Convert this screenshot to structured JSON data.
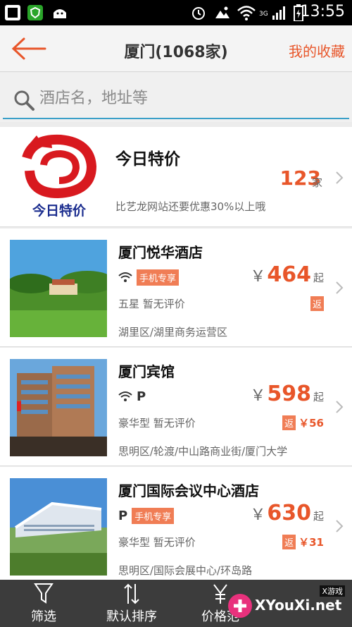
{
  "status_bar": {
    "network": "3G",
    "time": "13:55"
  },
  "header": {
    "title": "厦门(1068家)",
    "favorites_label": "我的收藏"
  },
  "search": {
    "placeholder": "酒店名，地址等"
  },
  "promo": {
    "logo_caption": "今日特价",
    "title": "今日特价",
    "count": "123",
    "unit": "家",
    "description": "比艺龙网站还要优惠30%以上哦"
  },
  "hotels": [
    {
      "name": "厦门悦华酒店",
      "tag": "手机专享",
      "parking": "",
      "currency": "￥",
      "price": "464",
      "price_suffix": "起",
      "grade": "五星  暂无评价",
      "rebate_label": "返",
      "rebate_value": "",
      "address": "湖里区/湖里商务运营区"
    },
    {
      "name": "厦门宾馆",
      "tag": "",
      "parking": "P",
      "currency": "￥",
      "price": "598",
      "price_suffix": "起",
      "grade": "豪华型  暂无评价",
      "rebate_label": "返",
      "rebate_value": "￥56",
      "address": "思明区/轮渡/中山路商业街/厦门大学"
    },
    {
      "name": "厦门国际会议中心酒店",
      "tag": "手机专享",
      "parking": "P",
      "currency": "￥",
      "price": "630",
      "price_suffix": "起",
      "grade": "豪华型  暂无评价",
      "rebate_label": "返",
      "rebate_value": "￥31",
      "address": "思明区/国际会展中心/环岛路"
    }
  ],
  "toolbar": {
    "filter_label": "筛选",
    "sort_label": "默认排序",
    "price_label": "价格范"
  },
  "watermark": {
    "text": "XYouXi.net",
    "small": "X游戏"
  },
  "colors": {
    "accent": "#e8562a",
    "tag": "#f07d55",
    "toolbar": "#3c3c3c",
    "search_underline": "#3a9fc8"
  }
}
